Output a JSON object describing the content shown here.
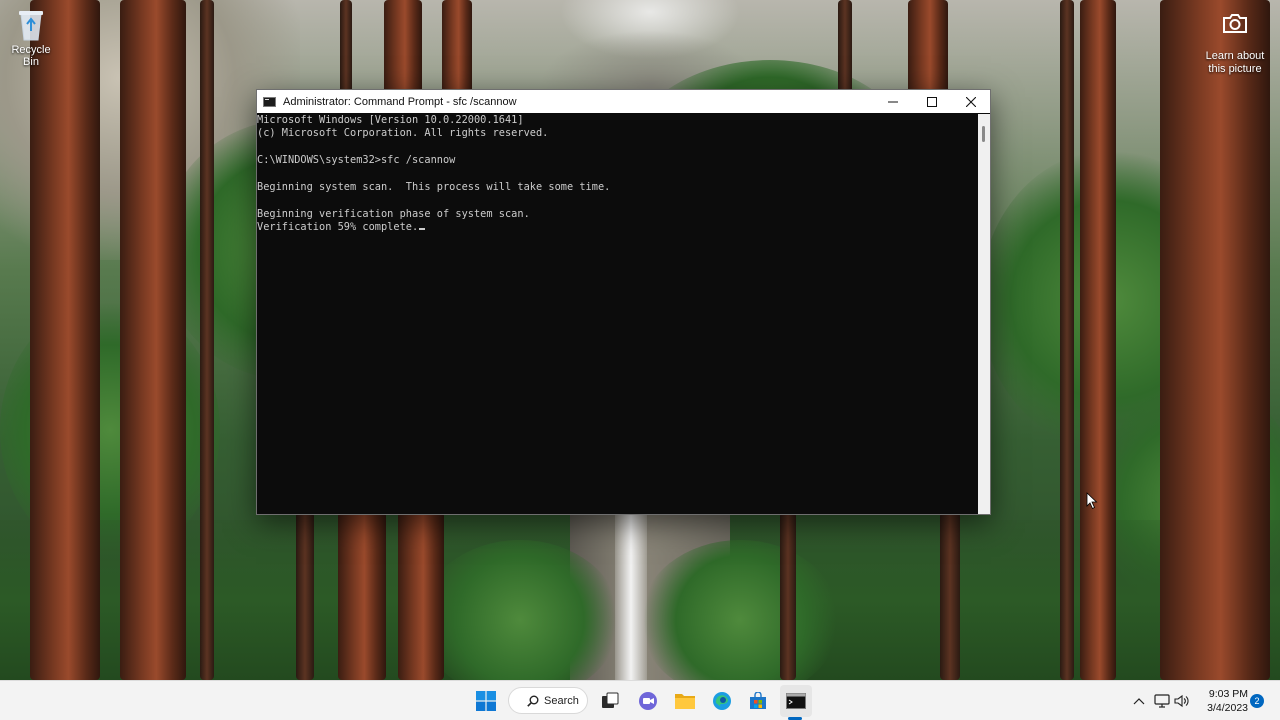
{
  "desktop": {
    "recycle_bin_label": "Recycle Bin",
    "learn_about_line1": "Learn about",
    "learn_about_line2": "this picture"
  },
  "window": {
    "title": "Administrator: Command Prompt - sfc  /scannow",
    "controls": [
      "minimize-icon",
      "maximize-icon",
      "close-icon"
    ],
    "console_lines": [
      "Microsoft Windows [Version 10.0.22000.1641]",
      "(c) Microsoft Corporation. All rights reserved.",
      "",
      "C:\\WINDOWS\\system32>sfc /scannow",
      "",
      "Beginning system scan.  This process will take some time.",
      "",
      "Beginning verification phase of system scan.",
      "Verification 59% complete."
    ]
  },
  "taskbar": {
    "search_label": "Search",
    "apps": [
      "start-icon",
      "search-icon",
      "task-view-icon",
      "chat-icon",
      "file-explorer-icon",
      "edge-icon",
      "store-icon",
      "command-prompt-icon"
    ],
    "tray": [
      "chevron-up-icon",
      "network-icon",
      "volume-icon"
    ],
    "time": "9:03 PM",
    "date": "3/4/2023",
    "notification_count": "2"
  },
  "colors": {
    "console_bg": "#0c0c0c",
    "console_text": "#cccccc",
    "accent": "#0067c0",
    "taskbar_bg": "#f3f3f3"
  }
}
